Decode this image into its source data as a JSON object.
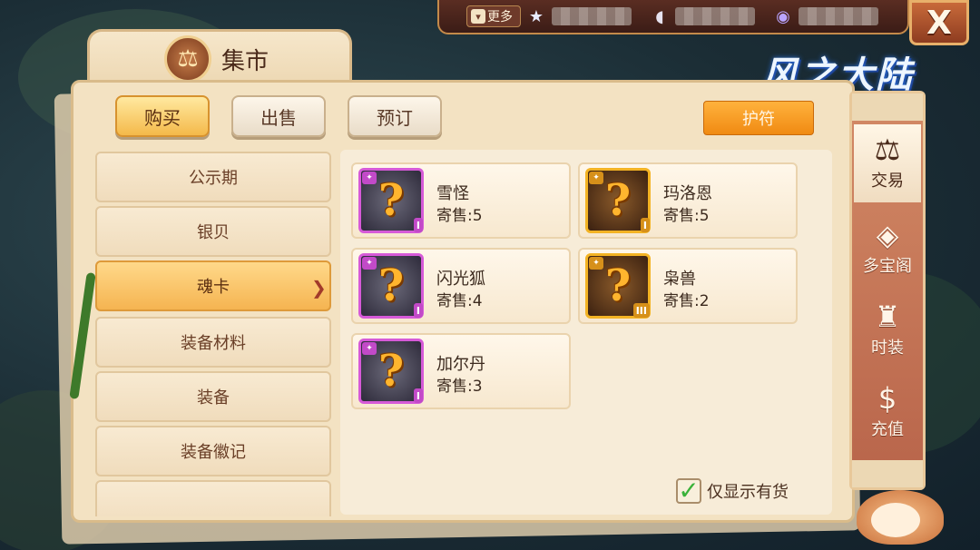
{
  "topbar": {
    "more_label": "更多",
    "resources": [
      {
        "icon": "star-icon"
      },
      {
        "icon": "shell-icon"
      },
      {
        "icon": "crystal-icon"
      }
    ]
  },
  "window": {
    "title": "集市",
    "close_label": "X",
    "logo_text": "风之大陆"
  },
  "tabs": [
    {
      "label": "购买",
      "active": true
    },
    {
      "label": "出售",
      "active": false
    },
    {
      "label": "预订",
      "active": false
    }
  ],
  "filter_button": "护符",
  "categories": [
    {
      "label": "公示期",
      "active": false
    },
    {
      "label": "银贝",
      "active": false
    },
    {
      "label": "魂卡",
      "active": true
    },
    {
      "label": "装备材料",
      "active": false
    },
    {
      "label": "装备",
      "active": false
    },
    {
      "label": "装备徽记",
      "active": false
    }
  ],
  "items": [
    {
      "name": "雪怪",
      "count": "寄售:5",
      "tier": "I",
      "rarity": "purple"
    },
    {
      "name": "玛洛恩",
      "count": "寄售:5",
      "tier": "I",
      "rarity": "gold"
    },
    {
      "name": "闪光狐",
      "count": "寄售:4",
      "tier": "I",
      "rarity": "purple"
    },
    {
      "name": "枭兽",
      "count": "寄售:2",
      "tier": "III",
      "rarity": "gold"
    },
    {
      "name": "加尔丹",
      "count": "寄售:3",
      "tier": "I",
      "rarity": "purple"
    }
  ],
  "in_stock_label": "仅显示有货",
  "in_stock_checked": true,
  "side_nav": [
    {
      "label": "交易",
      "icon": "scale-icon",
      "active": true
    },
    {
      "label": "多宝阁",
      "icon": "treasure-icon",
      "active": false
    },
    {
      "label": "时装",
      "icon": "clothing-icon",
      "active": false
    },
    {
      "label": "充值",
      "icon": "dollar-icon",
      "active": false
    }
  ],
  "colors": {
    "active_tab": "#f4b94a",
    "amulet_button": "#f08a12",
    "purple_frame": "#d65ad8",
    "gold_frame": "#f3b324",
    "side_nav_bg": "#c9765a"
  }
}
